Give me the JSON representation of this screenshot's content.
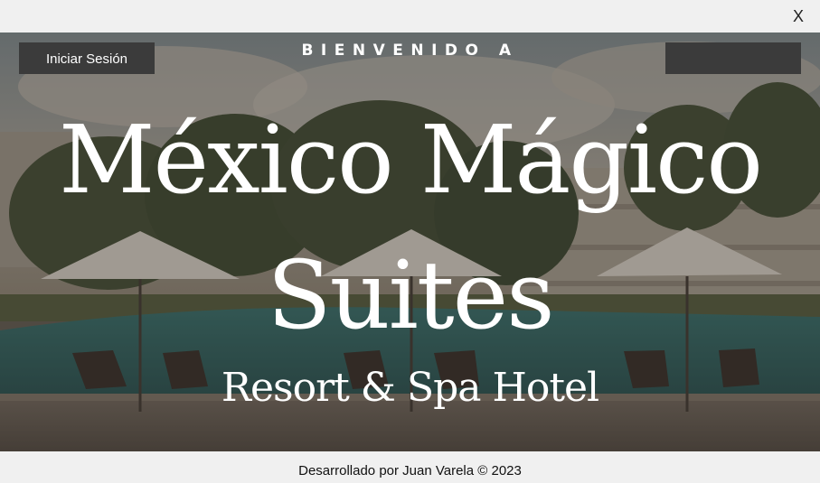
{
  "window": {
    "close_label": "X"
  },
  "header": {
    "login_label": "Iniciar Sesión",
    "right_button_label": ""
  },
  "hero": {
    "welcome": "BIENVENIDO A",
    "title_line_1": "México Mágico",
    "title_line_2": "Suites",
    "subtitle": "Resort & Spa Hotel"
  },
  "footer": {
    "credit": "Desarrollado por Juan Varela © 2023"
  }
}
